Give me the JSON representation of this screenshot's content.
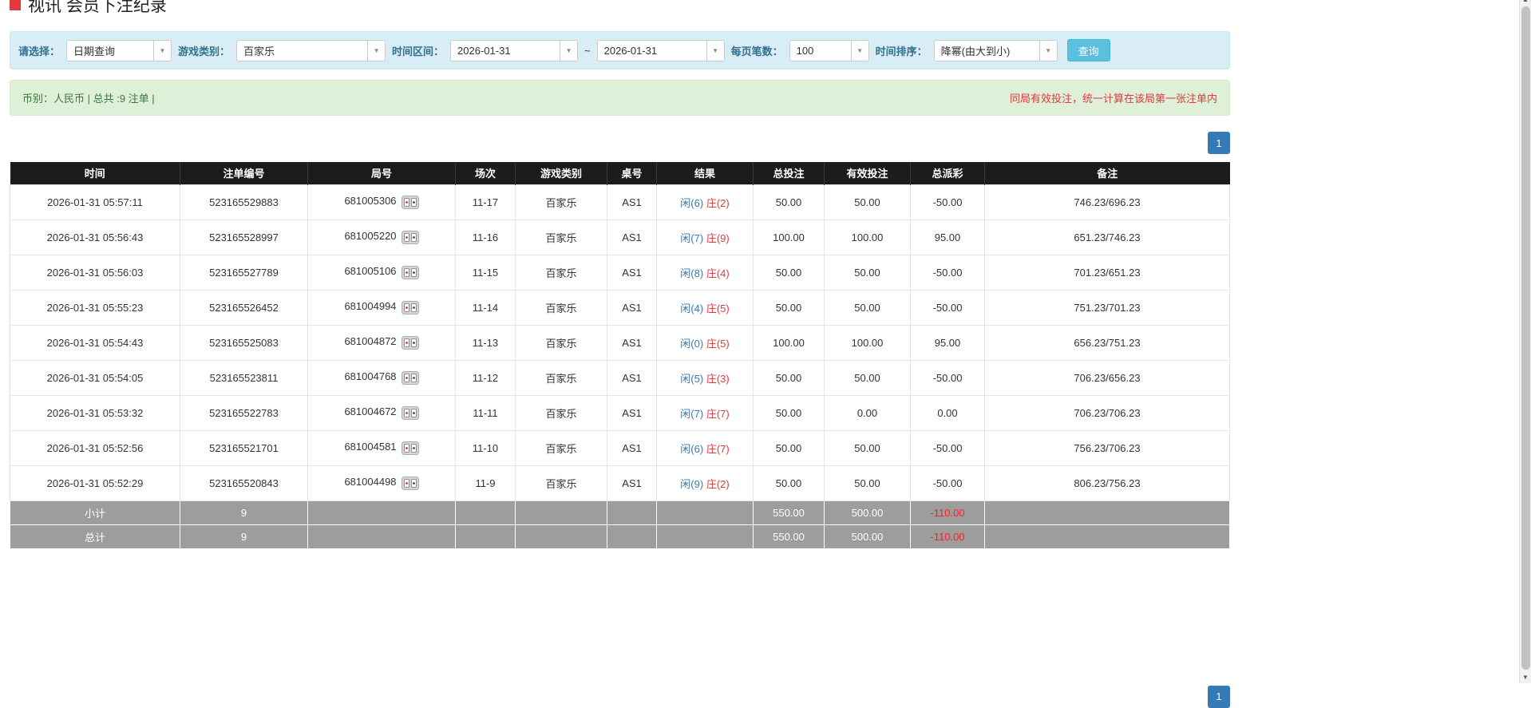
{
  "colors": {
    "accent_blue": "#337ab7",
    "info_bg": "#d9edf7",
    "info_text": "#31708f",
    "success_bg": "#dff0d8",
    "success_text": "#3c763d",
    "button_info": "#5bc0de",
    "player_blue": "#337ab7",
    "banker_red": "#e4393c",
    "negative_red": "#e60000",
    "notice_red": "#e4393c",
    "header_black": "#1c1c1c",
    "footer_gray": "#9d9d9d",
    "title_bullet_red": "#e4393c"
  },
  "icons": {
    "chevron_down_glyph": "▼",
    "scroll_up_glyph": "▲",
    "scroll_down_glyph": "▼"
  },
  "page": {
    "title": "视讯 会员下注纪录"
  },
  "filters": {
    "select_label": "请选择：",
    "select_value": "日期查询",
    "game_label": "游戏类别：",
    "game_value": "百家乐",
    "range_label": "时间区间：",
    "date_from": "2026-01-31",
    "date_to": "2026-01-31",
    "range_separator": "~",
    "page_size_label": "每页笔数：",
    "page_size_value": "100",
    "sort_label": "时间排序：",
    "sort_value": "降幂(由大到小)",
    "search_button": "查询"
  },
  "summary": {
    "left_text": "币别：人民币 | 总共 :9 注单 |",
    "right_notice": "同局有效投注，统一计算在该局第一张注单内"
  },
  "pagination": {
    "current_page": "1"
  },
  "table": {
    "headers": [
      "时间",
      "注单编号",
      "局号",
      "场次",
      "游戏类别",
      "桌号",
      "结果",
      "总投注",
      "有效投注",
      "总派彩",
      "备注"
    ],
    "rows": [
      {
        "time": "2026-01-31 05:57:11",
        "bet_id": "523165529883",
        "round": "681005306",
        "session": "11-17",
        "game": "百家乐",
        "table_no": "AS1",
        "player": "闲(6)",
        "banker": "庄(2)",
        "total_bet": "50.00",
        "valid_bet": "50.00",
        "payout": "-50.00",
        "remark": "746.23/696.23"
      },
      {
        "time": "2026-01-31 05:56:43",
        "bet_id": "523165528997",
        "round": "681005220",
        "session": "11-16",
        "game": "百家乐",
        "table_no": "AS1",
        "player": "闲(7)",
        "banker": "庄(9)",
        "total_bet": "100.00",
        "valid_bet": "100.00",
        "payout": "95.00",
        "remark": "651.23/746.23"
      },
      {
        "time": "2026-01-31 05:56:03",
        "bet_id": "523165527789",
        "round": "681005106",
        "session": "11-15",
        "game": "百家乐",
        "table_no": "AS1",
        "player": "闲(8)",
        "banker": "庄(4)",
        "total_bet": "50.00",
        "valid_bet": "50.00",
        "payout": "-50.00",
        "remark": "701.23/651.23"
      },
      {
        "time": "2026-01-31 05:55:23",
        "bet_id": "523165526452",
        "round": "681004994",
        "session": "11-14",
        "game": "百家乐",
        "table_no": "AS1",
        "player": "闲(4)",
        "banker": "庄(5)",
        "total_bet": "50.00",
        "valid_bet": "50.00",
        "payout": "-50.00",
        "remark": "751.23/701.23"
      },
      {
        "time": "2026-01-31 05:54:43",
        "bet_id": "523165525083",
        "round": "681004872",
        "session": "11-13",
        "game": "百家乐",
        "table_no": "AS1",
        "player": "闲(0)",
        "banker": "庄(5)",
        "total_bet": "100.00",
        "valid_bet": "100.00",
        "payout": "95.00",
        "remark": "656.23/751.23"
      },
      {
        "time": "2026-01-31 05:54:05",
        "bet_id": "523165523811",
        "round": "681004768",
        "session": "11-12",
        "game": "百家乐",
        "table_no": "AS1",
        "player": "闲(5)",
        "banker": "庄(3)",
        "total_bet": "50.00",
        "valid_bet": "50.00",
        "payout": "-50.00",
        "remark": "706.23/656.23"
      },
      {
        "time": "2026-01-31 05:53:32",
        "bet_id": "523165522783",
        "round": "681004672",
        "session": "11-11",
        "game": "百家乐",
        "table_no": "AS1",
        "player": "闲(7)",
        "banker": "庄(7)",
        "total_bet": "50.00",
        "valid_bet": "0.00",
        "payout": "0.00",
        "remark": "706.23/706.23"
      },
      {
        "time": "2026-01-31 05:52:56",
        "bet_id": "523165521701",
        "round": "681004581",
        "session": "11-10",
        "game": "百家乐",
        "table_no": "AS1",
        "player": "闲(6)",
        "banker": "庄(7)",
        "total_bet": "50.00",
        "valid_bet": "50.00",
        "payout": "-50.00",
        "remark": "756.23/706.23"
      },
      {
        "time": "2026-01-31 05:52:29",
        "bet_id": "523165520843",
        "round": "681004498",
        "session": "11-9",
        "game": "百家乐",
        "table_no": "AS1",
        "player": "闲(9)",
        "banker": "庄(2)",
        "total_bet": "50.00",
        "valid_bet": "50.00",
        "payout": "-50.00",
        "remark": "806.23/756.23"
      }
    ],
    "subtotal": {
      "label": "小计",
      "count": "9",
      "total_bet": "550.00",
      "valid_bet": "500.00",
      "payout": "-110.00"
    },
    "grand_total": {
      "label": "总计",
      "count": "9",
      "total_bet": "550.00",
      "valid_bet": "500.00",
      "payout": "-110.00"
    }
  }
}
